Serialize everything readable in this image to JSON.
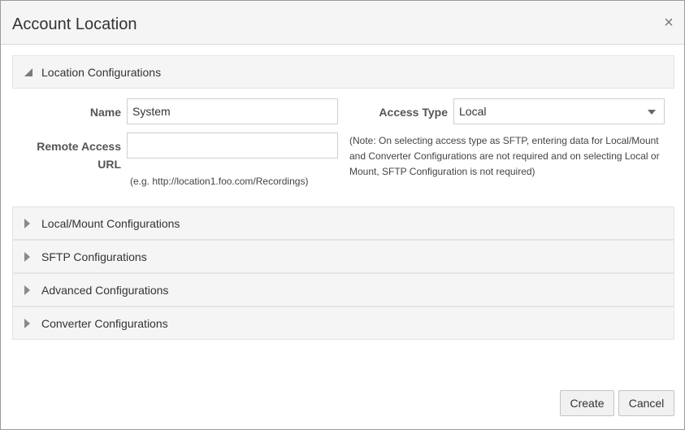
{
  "dialog": {
    "title": "Account Location",
    "close_glyph": "×"
  },
  "location_panel": {
    "label": "Location Configurations",
    "expanded": true,
    "name_label": "Name",
    "name_value": "System",
    "remote_url_label_line1": "Remote Access",
    "remote_url_label_line2": "URL",
    "remote_url_value": "",
    "remote_url_hint": "(e.g. http://location1.foo.com/Recordings)",
    "access_type_label": "Access Type",
    "access_type_value": "Local",
    "access_note_line1": "(Note: On selecting access type as SFTP, entering data for Local/Mount",
    "access_note_line2": "and Converter Configurations are not required and on selecting Local or",
    "access_note_line3": "Mount, SFTP Configuration is not required)"
  },
  "collapsed_panels": [
    {
      "label": "Local/Mount Configurations"
    },
    {
      "label": "SFTP Configurations"
    },
    {
      "label": "Advanced Configurations"
    },
    {
      "label": "Converter Configurations"
    }
  ],
  "footer": {
    "create_label": "Create",
    "cancel_label": "Cancel"
  },
  "icons": {
    "expanded_triangle": "triangle-expanded-icon",
    "collapsed_triangle": "triangle-collapsed-icon",
    "dropdown_arrow": "chevron-down-icon",
    "close": "close-icon"
  },
  "colors": {
    "header_bg": "#f5f5f5",
    "border": "#d9d9d9",
    "text": "#333333"
  }
}
